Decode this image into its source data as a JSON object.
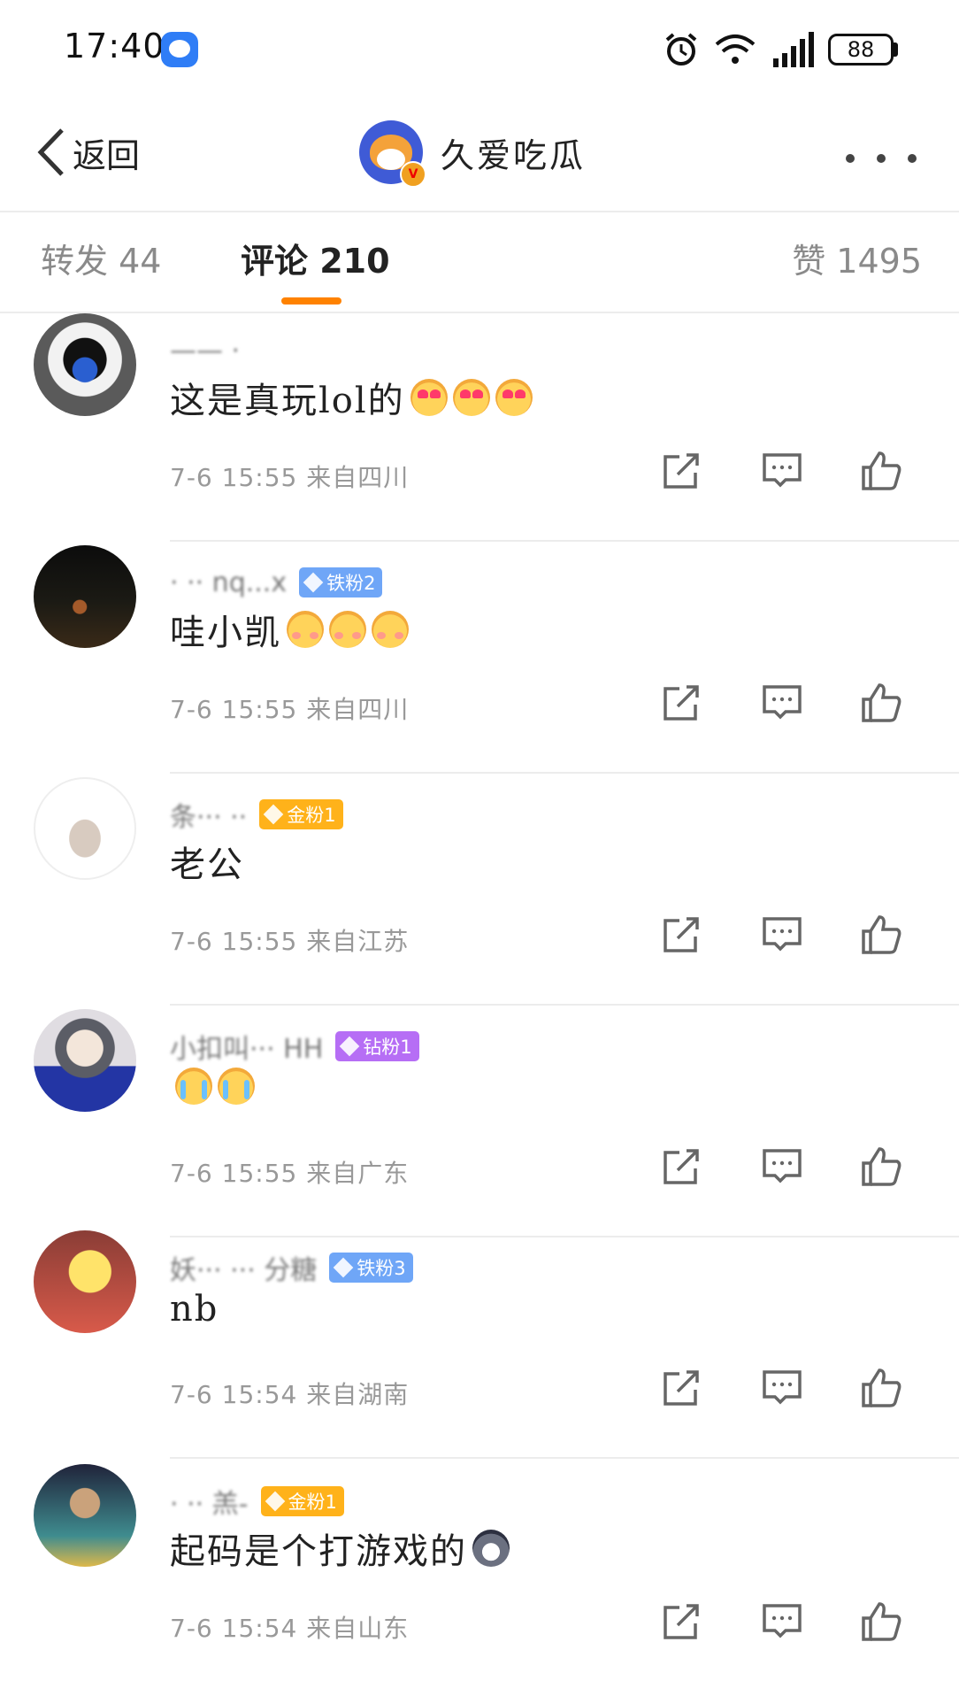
{
  "status_bar": {
    "time": "17:40",
    "battery": "88"
  },
  "nav": {
    "back_label": "返回",
    "title": "久爱吃瓜",
    "verified_mark": "V"
  },
  "tabs": {
    "repost": "转发 44",
    "comment": "评论 210",
    "like": "赞 1495"
  },
  "comments": [
    {
      "username": "—— ·",
      "badge": "",
      "text": "这是真玩lol的",
      "emoji": [
        "heart-eyes-emoji",
        "heart-eyes-emoji",
        "heart-eyes-emoji"
      ],
      "meta": "7-6 15:55 来自四川"
    },
    {
      "username": "· ·· nq...x",
      "badge": "铁粉2",
      "badge_type": "iron",
      "text": "哇小凯",
      "emoji": [
        "shy-smile-emoji",
        "shy-smile-emoji",
        "shy-smile-emoji"
      ],
      "meta": "7-6 15:55 来自四川"
    },
    {
      "username": "条··· ··",
      "badge": "金粉1",
      "badge_type": "gold",
      "text": "老公",
      "emoji": [],
      "meta": "7-6 15:55 来自江苏"
    },
    {
      "username": "小扣叫··· HH",
      "badge": "钻粉1",
      "badge_type": "diamond",
      "text": "",
      "emoji": [
        "crying-laugh-emoji",
        "crying-laugh-emoji"
      ],
      "meta": "7-6 15:55 来自广东"
    },
    {
      "username": "妖··· ··· 分糖",
      "badge": "铁粉3",
      "badge_type": "iron",
      "text": "nb",
      "emoji": [],
      "meta": "7-6 15:54 来自湖南"
    },
    {
      "username": "· ·· 羔-",
      "badge": "金粉1",
      "badge_type": "gold",
      "text": "起码是个打游戏的",
      "emoji": [
        "husky-emoji"
      ],
      "meta": "7-6 15:54 来自山东"
    }
  ]
}
